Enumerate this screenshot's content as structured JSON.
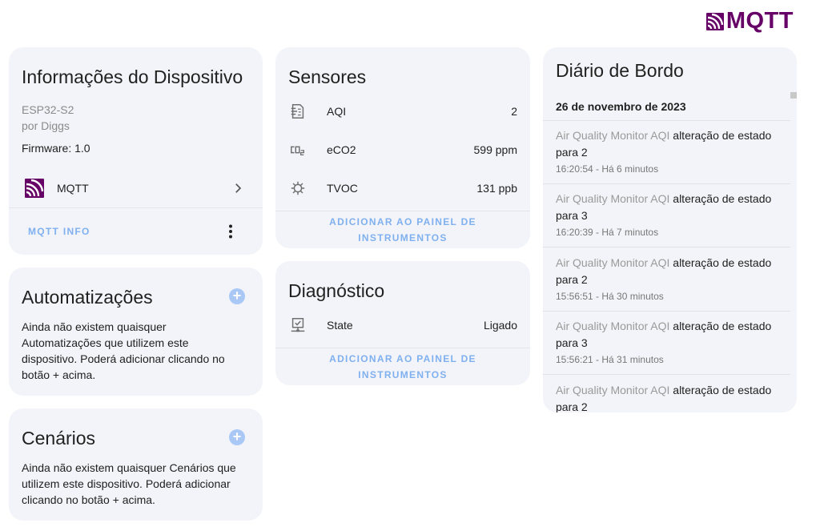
{
  "brand": {
    "logo_text": "MQTT",
    "color": "#660066"
  },
  "device_info": {
    "title": "Informações do Dispositivo",
    "model": "ESP32-S2",
    "manufacturer": "por Diggs",
    "firmware": "Firmware: 1.0",
    "integration_label": "MQTT",
    "integration_icon": "mqtt-icon",
    "action_label": "MQTT INFO"
  },
  "automations": {
    "title": "Automatizações",
    "text": "Ainda não existem quaisquer Automatizações que utilizem este dispositivo. Poderá adicionar clicando no botão + acima."
  },
  "scenes": {
    "title": "Cenários",
    "text": "Ainda não existem quaisquer Cenários que utilizem este dispositivo. Poderá adicionar clicando no botão + acima."
  },
  "sensors": {
    "title": "Sensores",
    "items": [
      {
        "name": "AQI",
        "value": "2",
        "icon": "air-filter-icon"
      },
      {
        "name": "eCO2",
        "value": "599 ppm",
        "icon": "molecule-co2-icon"
      },
      {
        "name": "TVOC",
        "value": "131 ppb",
        "icon": "virus-icon"
      }
    ],
    "action_label": "ADICIONAR AO PAINEL DE INSTRUMENTOS"
  },
  "diagnostics": {
    "title": "Diagnóstico",
    "items": [
      {
        "name": "State",
        "value": "Ligado",
        "icon": "lan-connect-icon"
      }
    ],
    "action_label": "ADICIONAR AO PAINEL DE INSTRUMENTOS"
  },
  "logbook": {
    "title": "Diário de Bordo",
    "date": "26 de novembro de 2023",
    "entries": [
      {
        "source": "Air Quality Monitor AQI",
        "message": "alteração de estado para 2",
        "time": "16:20:54 - Há 6 minutos"
      },
      {
        "source": "Air Quality Monitor AQI",
        "message": "alteração de estado para 3",
        "time": "16:20:39 - Há 7 minutos"
      },
      {
        "source": "Air Quality Monitor AQI",
        "message": "alteração de estado para 2",
        "time": "15:56:51 - Há 30 minutos"
      },
      {
        "source": "Air Quality Monitor AQI",
        "message": "alteração de estado para 3",
        "time": "15:56:21 - Há 31 minutos"
      },
      {
        "source": "Air Quality Monitor AQI",
        "message": "alteração de estado para 2",
        "time": ""
      }
    ]
  }
}
